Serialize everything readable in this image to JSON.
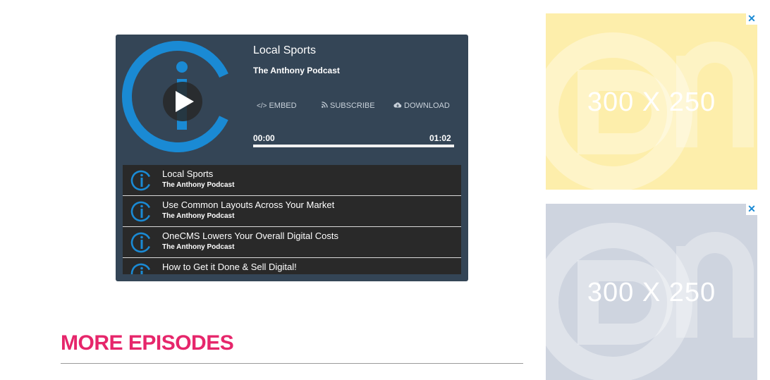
{
  "player": {
    "episode_title": "Local Sports",
    "show_name": "The Anthony Podcast",
    "actions": {
      "embed": "EMBED",
      "subscribe": "SUBSCRIBE",
      "download": "DOWNLOAD"
    },
    "time_current": "00:00",
    "time_duration": "01:02",
    "progress_fraction": 0.0,
    "brand_color": "#1a8ad4",
    "panel_color": "#344556"
  },
  "playlist": [
    {
      "title": "Local Sports",
      "show": "The Anthony Podcast"
    },
    {
      "title": "Use Common Layouts Across Your Market",
      "show": "The Anthony Podcast"
    },
    {
      "title": "OneCMS Lowers Your Overall Digital Costs",
      "show": "The Anthony Podcast"
    },
    {
      "title": "How to Get it Done & Sell Digital!",
      "show": ""
    }
  ],
  "more_episodes": {
    "heading": "MORE EPISODES",
    "color": "#e6266b"
  },
  "ads": [
    {
      "label": "300 X 250",
      "close": "✕",
      "background": "#fdeeab"
    },
    {
      "label": "300 X 250",
      "close": "✕",
      "background": "#ced4df"
    }
  ]
}
